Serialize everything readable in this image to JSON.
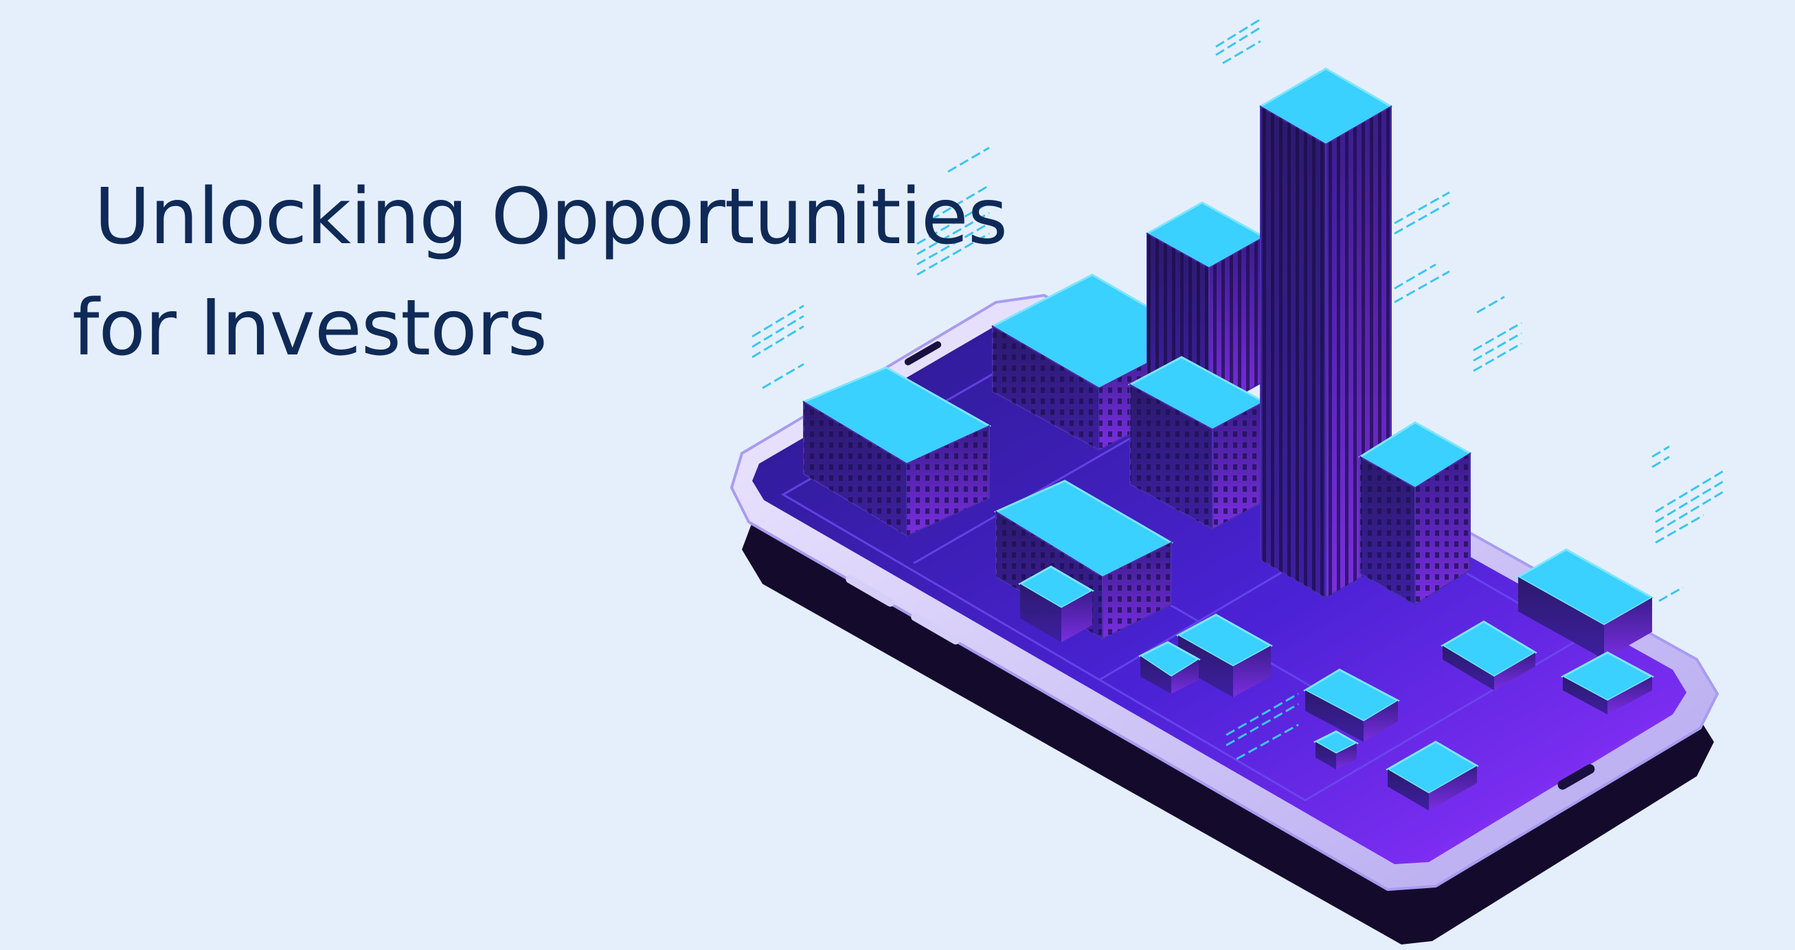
{
  "hero": {
    "title_line1": "Unlocking Opportunities",
    "title_line2": "for Investors"
  },
  "illustration": {
    "subject": "isometric-city-on-smartphone"
  },
  "colors": {
    "background": "#e5effc",
    "title": "#0f2a57",
    "roof": "#3ad0ff",
    "building": "#3a1e8a",
    "screen": "#4a1fd0",
    "phone_frame": "#c9c0f5",
    "accent": "#e53cf0"
  }
}
